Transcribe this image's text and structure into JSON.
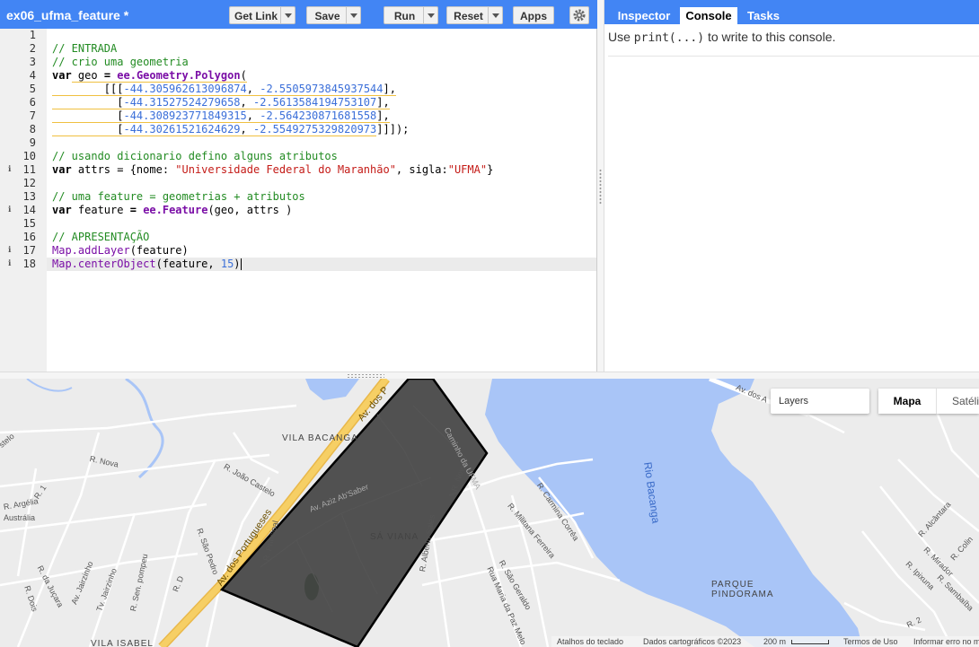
{
  "editor": {
    "script_title": "ex06_ufma_feature *",
    "buttons": {
      "get_link": "Get Link",
      "save": "Save",
      "run": "Run",
      "reset": "Reset",
      "apps": "Apps"
    },
    "gear_icon": "gear-icon",
    "line_numbers": [
      "1",
      "2",
      "3",
      "4",
      "5",
      "6",
      "7",
      "8",
      "9",
      "10",
      "11",
      "12",
      "13",
      "14",
      "15",
      "16",
      "17",
      "18"
    ],
    "code": {
      "l2": "// ENTRADA",
      "l3": "// crio uma geometria",
      "l4_kw": "var",
      "l4_var": " geo ",
      "l4_eq": "=",
      "l4_sp": " ",
      "l4_fn": "ee.Geometry.Polygon",
      "l4_paren": "(",
      "l5_open": "[[[",
      "l5_a": "-44.305962613096874",
      "l5_b": "-2.5505973845937544",
      "l6_a": "-44.31527524279658",
      "l6_b": "-2.5613584194753107",
      "l7_a": "-44.308923771849315",
      "l7_b": "-2.564230871681558",
      "l8_a": "-44.30261521624629",
      "l8_b": "-2.5549275329820973",
      "l8_close": "]]]);",
      "l10": "// usando dicionario defino alguns atributos",
      "l11_kw": "var",
      "l11_rest": " attrs = {nome: ",
      "l11_str1": "\"Universidade Federal do Maranhão\"",
      "l11_mid": ", sigla:",
      "l11_str2": "\"UFMA\"",
      "l11_end": "}",
      "l13": "// uma feature = geometrias + atributos",
      "l14_kw": "var",
      "l14_var": " feature ",
      "l14_eq": "=",
      "l14_sp": " ",
      "l14_fn": "ee.Feature",
      "l14_rest": "(geo, attrs )",
      "l16": "// APRESENTAÇÃO",
      "l17_fn": "Map.addLayer",
      "l17_rest": "(feature)",
      "l18_fn": "Map.centerObject",
      "l18_rest": "(feature, ",
      "l18_num": "15",
      "l18_close": ")"
    }
  },
  "right_panel": {
    "tabs": [
      "Inspector",
      "Console",
      "Tasks"
    ],
    "active_tab": "Console",
    "console_hint_pre": "Use ",
    "console_hint_code": "print(...)",
    "console_hint_post": " to write to this console."
  },
  "map": {
    "layers_label": "Layers",
    "map_types": [
      "Mapa",
      "Satélite"
    ],
    "active_map_type": "Mapa",
    "labels": {
      "av_portugueses": "Av. dos Portugueses",
      "av_portugueses_top": "Av. dos P",
      "av_portugueses_tr": "Av. dos A",
      "vila_bacanga": "VILA BACANGA",
      "sa_viana": "SÁ VIANA",
      "rio_bacanga": "Rio Bacanga",
      "parque_line1": "PARQUE",
      "parque_line2": "PINDORAMA",
      "vila_isabel": "VILA ISABEL",
      "r_nova_left": "R. Nova",
      "r_joao_castelo": "R. João Castelo",
      "r_argelia": "R. Argélia",
      "australia": "Austrália",
      "r_1": "R. 1",
      "stelo": "stelo",
      "r_sao_pedro": "R. São Pedro",
      "r_principal": "R. Principal",
      "av_aziz": "Av. Aziz Ab'Saber",
      "r_nova_right": "R. Nova",
      "caminho_ufma": "Caminho da UFMA",
      "r_carmina": "R. Carmina Corrêa",
      "r_militana": "R. Militana Ferreira",
      "r_alberto": "R. Alberto Sales",
      "r_sao_geraldo": "R. São Geraldo",
      "rua_maria": "Rua Maria da Paz Melo",
      "r_dois": "R. Dois",
      "r_jucara": "R. da Juçara",
      "av_jairzinho": "Av. Jairzinho",
      "tv_jairzinho": "Tv. Jairzinho",
      "r_sen_pompeu": "R. Sen. pompeu",
      "r_d": "R. D",
      "r_alcantara": "R. Alcântara",
      "r_mirador": "R. Mirador",
      "r_ipixuna": "R. Ipixuna",
      "r_sambaiba": "R. Sambaíba",
      "r_colinas": "R. Colin",
      "r_2": "R. 2"
    },
    "attribution": {
      "keyboard": "Atalhos do teclado",
      "data": "Dados cartográficos ©2023",
      "scale": "200 m",
      "terms": "Termos de Uso",
      "report": "Informar erro no mapa"
    },
    "colors": {
      "water": "#a9c5f7",
      "land": "#ececec",
      "road": "#ffffff",
      "highway": "#f6cf65",
      "polygon_fill": "#3b3b3b",
      "park": "#c8e6c9",
      "accent_blue": "#4285f4"
    }
  }
}
